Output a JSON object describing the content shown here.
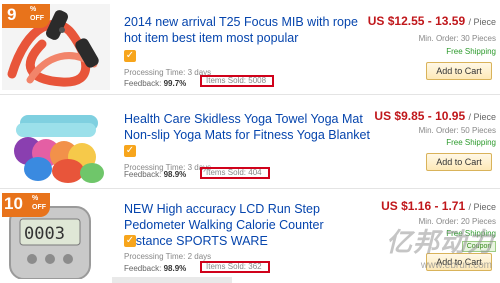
{
  "products": [
    {
      "discount": {
        "num": "9",
        "pct": "%",
        "off": "OFF"
      },
      "title": "2014 new arrival T25 Focus MIB with rope hot item best item most popular",
      "processing": "Processing Time: 3 days",
      "feedback_label": "Feedback:",
      "feedback_value": "99.7%",
      "items_sold": "Items Sold: 5008",
      "price": "US $12.55 - 13.59",
      "price_unit": "/ Piece",
      "min_order": "Min. Order: 30 Pieces",
      "shipping": "Free Shipping",
      "add_to_cart": "Add to Cart"
    },
    {
      "title": "Health Care Skidless Yoga Towel Yoga Mat Non-slip Yoga Mats for Fitness Yoga Blanket",
      "processing": "Processing Time: 3 days",
      "feedback_label": "Feedback:",
      "feedback_value": "98.9%",
      "items_sold": "Items Sold: 404",
      "price": "US $9.85 - 10.95",
      "price_unit": "/ Piece",
      "min_order": "Min. Order: 50 Pieces",
      "shipping": "Free Shipping",
      "add_to_cart": "Add to Cart"
    },
    {
      "discount": {
        "num": "10",
        "pct": "%",
        "off": "OFF"
      },
      "title": "NEW High accuracy LCD Run Step Pedometer Walking Calorie Counter Distance SPORTS WARE",
      "processing": "Processing Time: 2 days",
      "feedback_label": "Feedback:",
      "feedback_value": "98.9%",
      "items_sold": "Items Sold: 362",
      "price": "US $1.16 - 1.71",
      "price_unit": "/ Piece",
      "min_order": "Min. Order: 20 Pieces",
      "shipping": "Free Shipping",
      "coupon": "Coupon",
      "add_to_cart": "Add to Cart"
    }
  ],
  "watermark": {
    "text": "亿邦动力",
    "url": "www.ebrun.com"
  },
  "colors": {
    "title_link": "#0645ad",
    "price": "#c0171b",
    "discount_badge": "#e8731b",
    "free_shipping": "#2c9a2c",
    "sold_highlight": "#d0021b"
  },
  "icons": [
    "check-badge-icon"
  ]
}
